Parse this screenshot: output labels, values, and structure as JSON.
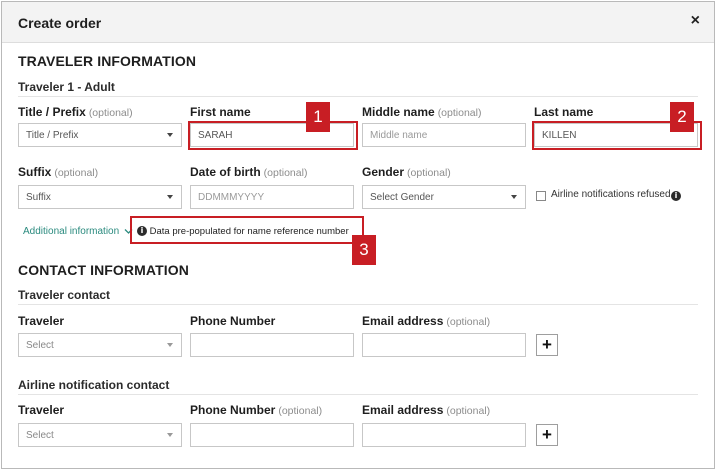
{
  "dialog": {
    "title": "Create order",
    "close_symbol": "×"
  },
  "traveler_info": {
    "heading": "TRAVELER INFORMATION",
    "subheading": "Traveler 1 - Adult",
    "title_prefix": {
      "label": "Title / Prefix",
      "optional": "(optional)",
      "value": "Title / Prefix"
    },
    "first_name": {
      "label": "First name",
      "value": "SARAH"
    },
    "middle_name": {
      "label": "Middle name",
      "optional": "(optional)",
      "placeholder": "Middle name"
    },
    "last_name": {
      "label": "Last name",
      "value": "KILLEN"
    },
    "suffix": {
      "label": "Suffix",
      "optional": "(optional)",
      "value": "Suffix"
    },
    "date_of_birth": {
      "label": "Date of birth",
      "optional": "(optional)",
      "placeholder": "DDMMMYYYY"
    },
    "gender": {
      "label": "Gender",
      "optional": "(optional)",
      "value": "Select Gender"
    },
    "airline_notifications": {
      "label": "Airline notifications refused",
      "icon": "info-icon"
    },
    "additional_info": {
      "label": "Additional information",
      "icon": "chevron-down-icon"
    },
    "note": {
      "text": "Data pre-populated for name reference number",
      "icon": "info-icon"
    }
  },
  "contact_info": {
    "heading": "CONTACT INFORMATION",
    "traveler_contact": {
      "subheading": "Traveler contact",
      "traveler": {
        "label": "Traveler",
        "value": "Select"
      },
      "phone": {
        "label": "Phone Number"
      },
      "email": {
        "label": "Email address",
        "optional": "(optional)"
      },
      "add_symbol": "+"
    },
    "airline_contact": {
      "subheading": "Airline notification contact",
      "traveler": {
        "label": "Traveler",
        "value": "Select"
      },
      "phone": {
        "label": "Phone Number",
        "optional": "(optional)"
      },
      "email": {
        "label": "Email address",
        "optional": "(optional)"
      },
      "add_symbol": "+"
    }
  },
  "callouts": [
    {
      "number": "1"
    },
    {
      "number": "2"
    },
    {
      "number": "3"
    }
  ],
  "colors": {
    "callout_red": "#c81e24",
    "link_teal": "#2a8a7e",
    "header_bg": "#f3f3f3"
  }
}
